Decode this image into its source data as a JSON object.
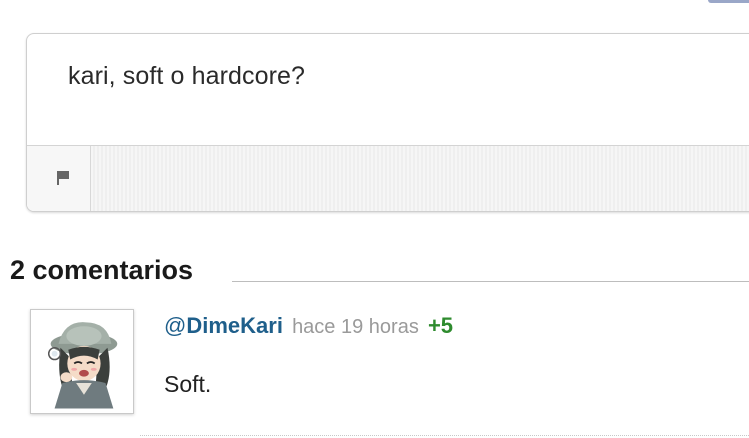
{
  "question": {
    "text": "kari, soft o hardcore?"
  },
  "icons": {
    "flag": "flag-icon",
    "avatar": "anime-character-avatar"
  },
  "comments_section": {
    "title": "2 comentarios"
  },
  "comments": [
    {
      "at": "@",
      "author": "DimeKari",
      "time": "hace 19 horas",
      "score": "+5",
      "body": "Soft."
    }
  ],
  "colors": {
    "author_link": "#1f5f8b",
    "score_positive": "#2e8b2e",
    "meta_text": "#9a9a9a"
  }
}
